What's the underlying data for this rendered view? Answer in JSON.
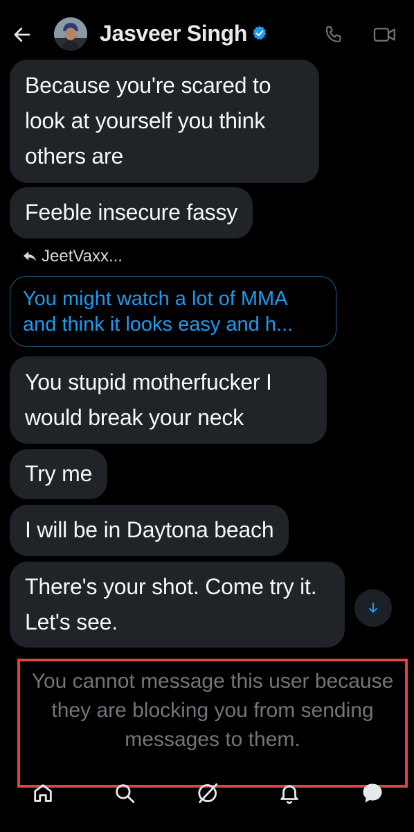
{
  "header": {
    "back_icon": "arrow-left-icon",
    "contact_name": "Jasveer Singh",
    "verified_icon": "verified-badge-icon",
    "call_icon": "phone-icon",
    "video_icon": "video-camera-icon"
  },
  "messages": [
    {
      "text": "Because you're scared to look at yourself you think others are"
    },
    {
      "text": "Feeble insecure fassy"
    },
    {
      "reply_to": "JeetVaxx...",
      "quoted_text": "You might watch a lot of MMA and think it looks easy and h..."
    },
    {
      "text": "You stupid motherfucker I would break your neck"
    },
    {
      "text": "Try me"
    },
    {
      "text": "I will be in Daytona beach"
    },
    {
      "text": "There's your shot. Come try it. Let's see."
    }
  ],
  "blocked_notice": "You cannot message this user because they are blocking you from sending messages to them.",
  "bottom_nav": [
    "home-icon",
    "search-icon",
    "grok-icon",
    "notifications-bell-icon",
    "messages-icon"
  ],
  "colors": {
    "background": "#000000",
    "bubble": "#202327",
    "accent": "#1d9bf0",
    "highlight_border": "#e0453c",
    "muted_text": "#71767b"
  }
}
